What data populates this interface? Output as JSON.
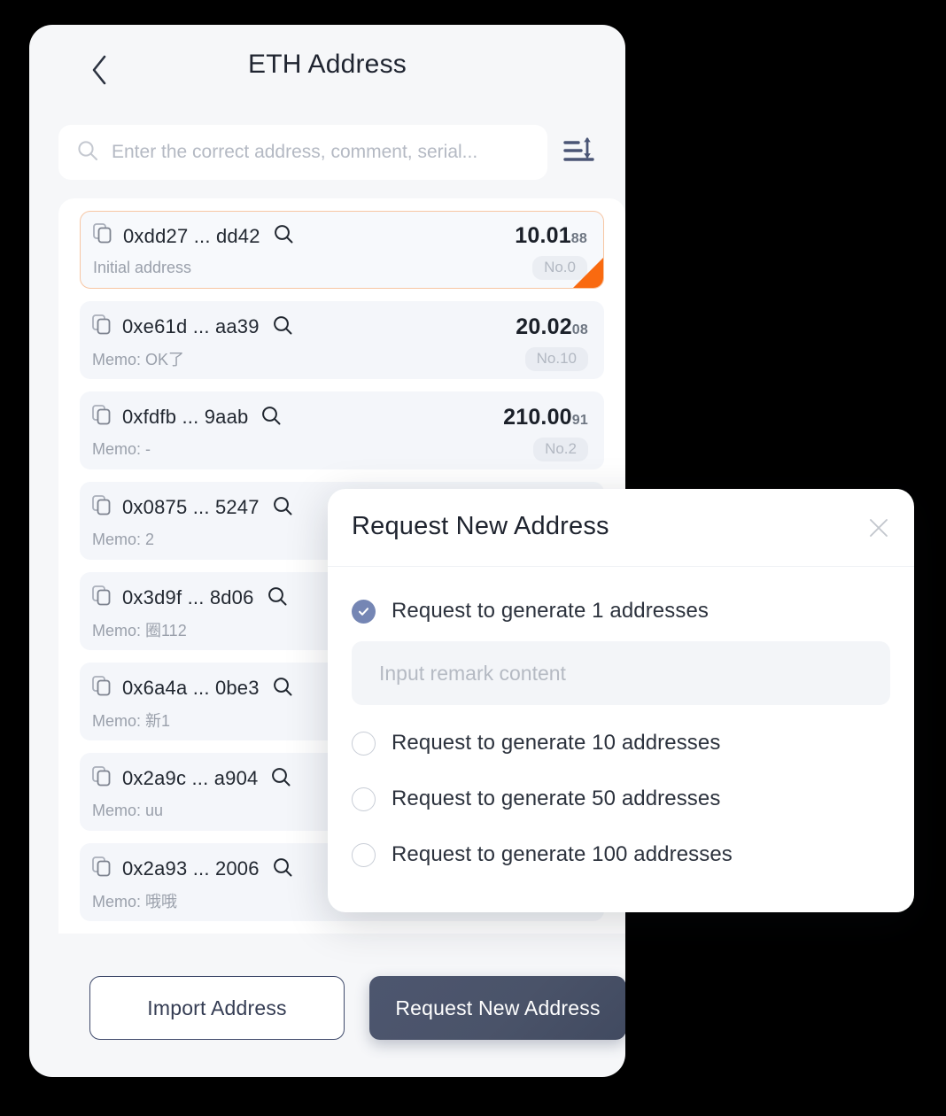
{
  "screen": {
    "background_color": "#000000",
    "card_background": "#f6f7f9"
  },
  "header": {
    "back_icon": "chevron-left-icon",
    "title": "ETH Address"
  },
  "search": {
    "icon": "search-icon",
    "placeholder": "Enter the correct address, comment, serial...",
    "value": "",
    "sort_icon": "sort-lines-icon"
  },
  "list": {
    "copy_icon": "copy-icon",
    "magnify_icon": "magnify-icon",
    "rows": [
      {
        "address": "0xdd27 ... dd42",
        "amount_main": "10.01",
        "amount_frac": "88",
        "memo": "Initial address",
        "no": "No.0",
        "selected": true,
        "flag_color": "#f96a10"
      },
      {
        "address": "0xe61d ... aa39",
        "amount_main": "20.02",
        "amount_frac": "08",
        "memo": "Memo: OK了",
        "no": "No.10",
        "selected": false
      },
      {
        "address": "0xfdfb ... 9aab",
        "amount_main": "210.00",
        "amount_frac": "91",
        "memo": "Memo: -",
        "no": "No.2",
        "selected": false
      },
      {
        "address": "0x0875 ... 5247",
        "amount_main": "",
        "amount_frac": "",
        "memo": "Memo: 2",
        "no": "",
        "selected": false
      },
      {
        "address": "0x3d9f ... 8d06",
        "amount_main": "",
        "amount_frac": "",
        "memo": "Memo: 圈112",
        "no": "",
        "selected": false
      },
      {
        "address": "0x6a4a ... 0be3",
        "amount_main": "",
        "amount_frac": "",
        "memo": "Memo: 新1",
        "no": "",
        "selected": false
      },
      {
        "address": "0x2a9c ... a904",
        "amount_main": "",
        "amount_frac": "",
        "memo": "Memo: uu",
        "no": "",
        "selected": false
      },
      {
        "address": "0x2a93 ... 2006",
        "amount_main": "",
        "amount_frac": "",
        "memo": "Memo: 哦哦",
        "no": "",
        "selected": false
      }
    ]
  },
  "footer": {
    "import_label": "Import Address",
    "request_label": "Request New Address",
    "request_button_color": "#4a5369"
  },
  "modal": {
    "title": "Request New Address",
    "close_icon": "close-icon",
    "options": [
      {
        "label": "Request to generate 1 addresses",
        "checked": true
      },
      {
        "label": "Request to generate 10 addresses",
        "checked": false
      },
      {
        "label": "Request to generate 50 addresses",
        "checked": false
      },
      {
        "label": "Request to generate 100 addresses",
        "checked": false
      }
    ],
    "remark_placeholder": "Input remark content",
    "remark_value": "",
    "checked_color": "#7586b4"
  }
}
